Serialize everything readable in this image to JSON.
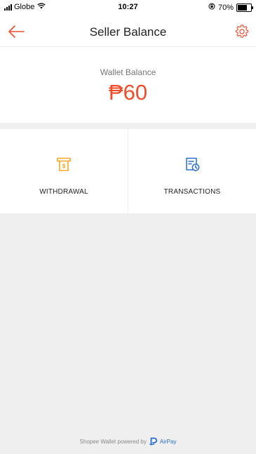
{
  "status_bar": {
    "carrier": "Globe",
    "time": "10:27",
    "battery_percent": "70%",
    "battery_level": 0.7
  },
  "nav": {
    "title": "Seller Balance"
  },
  "wallet": {
    "label": "Wallet Balance",
    "amount": "₱60"
  },
  "actions": [
    {
      "label": "WITHDRAWAL",
      "icon": "withdrawal-icon"
    },
    {
      "label": "TRANSACTIONS",
      "icon": "transactions-icon"
    }
  ],
  "footer": {
    "text": "Shopee Wallet powered by",
    "brand": "AirPay"
  },
  "colors": {
    "accent": "#ee4d2d",
    "withdrawal_icon": "#f5a623",
    "transactions_icon": "#2a6ecb",
    "background_gray": "#efefef"
  }
}
